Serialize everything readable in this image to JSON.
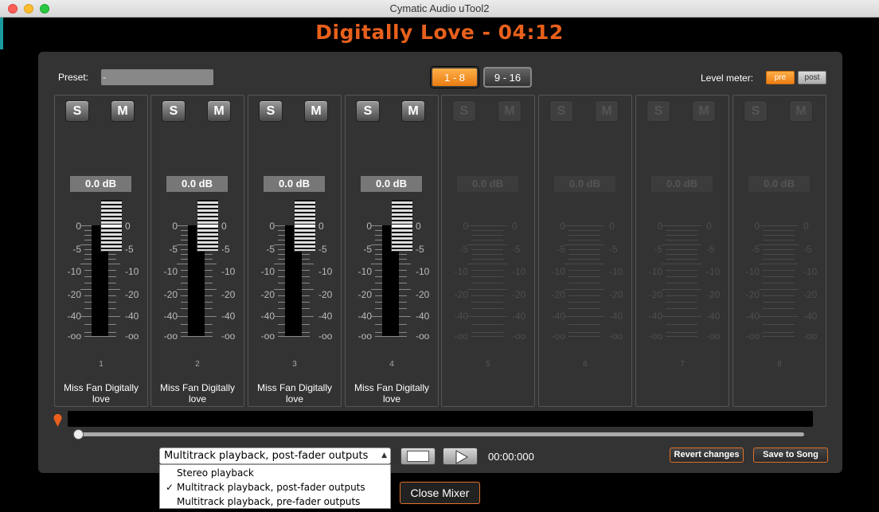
{
  "window": {
    "title": "Cymatic Audio uTool2"
  },
  "song_title": "Digitally Love  - 04:12",
  "preset": {
    "label": "Preset:",
    "value": "-"
  },
  "banks": [
    {
      "label": "1 - 8",
      "active": true
    },
    {
      "label": "9 - 16",
      "active": false
    }
  ],
  "level_meter": {
    "label": "Level meter:",
    "pre": "pre",
    "post": "post"
  },
  "scale": [
    "0",
    "-5",
    "-10",
    "-20",
    "-40",
    "-oo"
  ],
  "channels": [
    {
      "solo": "S",
      "mute": "M",
      "db": "0.0 dB",
      "number": "1",
      "name": "Miss Fan Digitally love",
      "enabled": true
    },
    {
      "solo": "S",
      "mute": "M",
      "db": "0.0 dB",
      "number": "2",
      "name": "Miss Fan Digitally love",
      "enabled": true
    },
    {
      "solo": "S",
      "mute": "M",
      "db": "0.0 dB",
      "number": "3",
      "name": "Miss Fan Digitally love",
      "enabled": true
    },
    {
      "solo": "S",
      "mute": "M",
      "db": "0.0 dB",
      "number": "4",
      "name": "Miss Fan Digitally love",
      "enabled": true
    },
    {
      "solo": "S",
      "mute": "M",
      "db": "0.0 dB",
      "number": "5",
      "name": "",
      "enabled": false
    },
    {
      "solo": "S",
      "mute": "M",
      "db": "0.0 dB",
      "number": "6",
      "name": "",
      "enabled": false
    },
    {
      "solo": "S",
      "mute": "M",
      "db": "0.0 dB",
      "number": "7",
      "name": "",
      "enabled": false
    },
    {
      "solo": "S",
      "mute": "M",
      "db": "0.0 dB",
      "number": "8",
      "name": "",
      "enabled": false
    }
  ],
  "playback": {
    "selected": "Multitrack playback, post-fader outputs",
    "options": [
      {
        "label": "Stereo playback",
        "checked": false
      },
      {
        "label": "Multitrack playback, post-fader outputs",
        "checked": true
      },
      {
        "label": "Multitrack playback, pre-fader outputs",
        "checked": false
      }
    ],
    "check_mark": "✓"
  },
  "transport": {
    "time": "00:00:000",
    "position": 0
  },
  "actions": {
    "revert": "Revert changes",
    "save": "Save to Song",
    "close": "Close Mixer"
  },
  "colors": {
    "accent": "#e8601c",
    "active_button": "#f39422"
  }
}
